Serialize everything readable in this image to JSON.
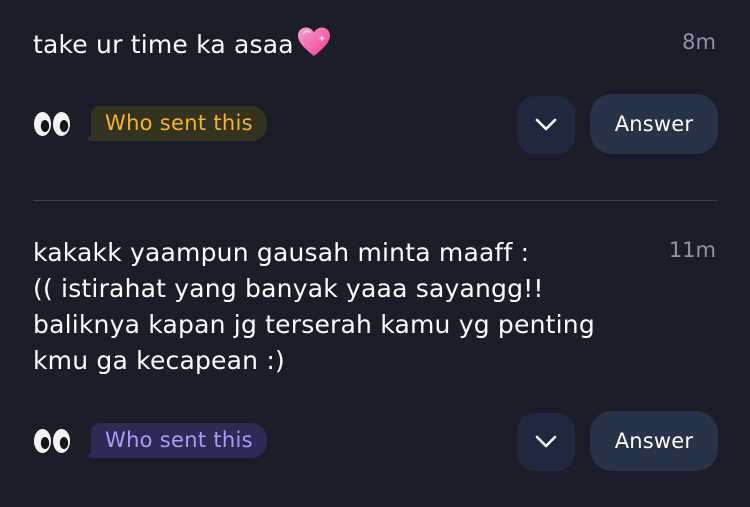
{
  "messages": [
    {
      "text": "take ur time ka asaa",
      "emoji": "heart-icon",
      "time": "8m",
      "badge_label": "Who sent this",
      "badge_color": "#f5b32c",
      "reaction_icon": "eyes-icon",
      "expand_icon": "chevron-down-icon",
      "answer_label": "Answer"
    },
    {
      "text": "kakakk yaampun gausah minta maaff :\n(( istirahat yang banyak yaaa sayangg!!\nbaliknya kapan jg terserah kamu yg penting\nkmu ga kecapean :)",
      "time": "11m",
      "badge_label": "Who sent this",
      "badge_color": "#a99cf6",
      "reaction_icon": "eyes-icon",
      "expand_icon": "chevron-down-icon",
      "answer_label": "Answer"
    }
  ],
  "colors": {
    "background": "#1b1e29",
    "timestamp": "#8e95a6",
    "answer_button": "#283248",
    "expand_button": "#1f283f",
    "heart": "#f472b6"
  }
}
